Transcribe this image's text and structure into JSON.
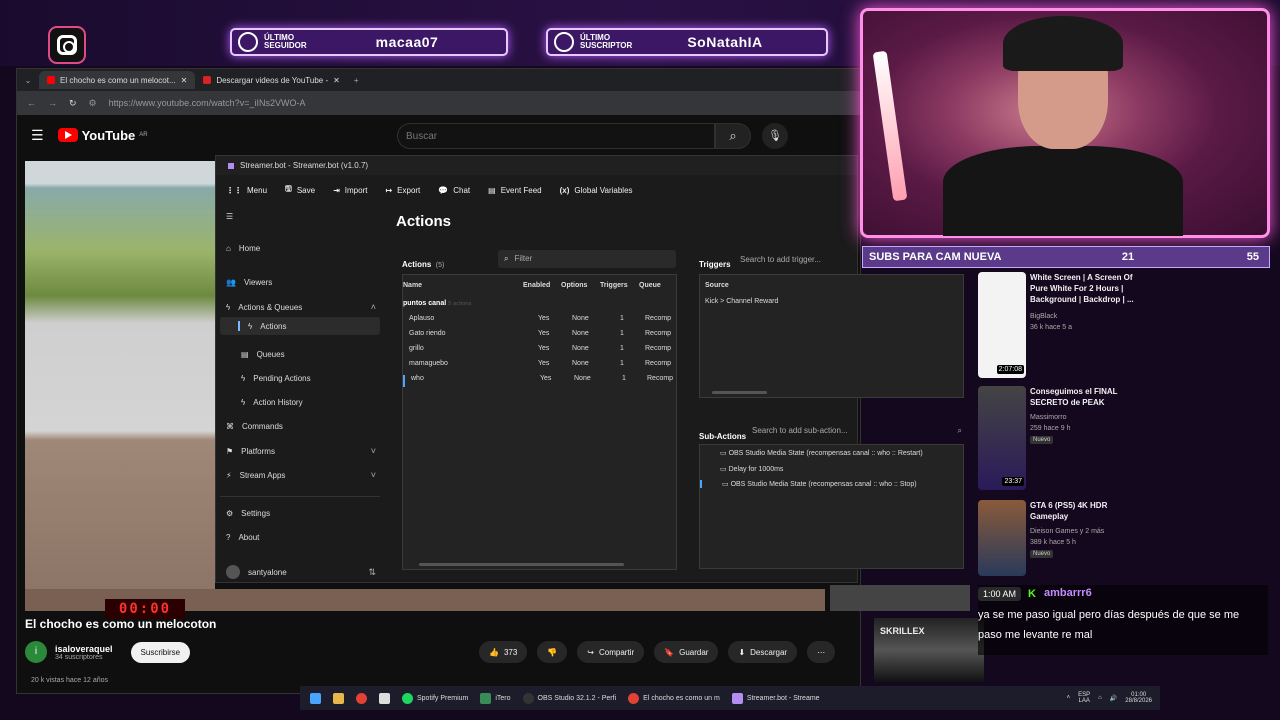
{
  "overlay": {
    "follower_label": "ÚLTIMO SEGUIDOR",
    "follower_name": "macaa07",
    "subscriber_label": "ÚLTIMO SUSCRIPTOR",
    "subscriber_name": "SoNatahIA",
    "subs_goal_label": "SUBS PARA CAM NUEVA",
    "subs_goal_current": "21",
    "subs_goal_target": "55",
    "timer": "00:00"
  },
  "browser": {
    "tabs": [
      "El chocho es como un melocot...",
      "Descargar videos de YouTube -"
    ],
    "url": "https://www.youtube.com/watch?v=_iINs2VWO-A"
  },
  "youtube": {
    "logo": "YouTube",
    "logo_region": "AR",
    "search_placeholder": "Buscar",
    "video_title": "El chocho es como un melocoton",
    "channel_initial": "i",
    "channel_name": "isaloveraquel",
    "channel_subs": "34 suscriptores",
    "subscribe": "Suscribirse",
    "likes": "373",
    "share": "Compartir",
    "save": "Guardar",
    "download": "Descargar",
    "views": "20 k vistas  hace 12 años"
  },
  "streamerbot": {
    "window_title": "Streamer.bot - Streamer.bot (v1.0.7)",
    "menu": [
      "Menu",
      "Save",
      "Import",
      "Export",
      "Chat",
      "Event Feed",
      "Global Variables"
    ],
    "sidebar": {
      "home": "Home",
      "viewers": "Viewers",
      "actions_queues": "Actions & Queues",
      "actions": "Actions",
      "queues": "Queues",
      "pending": "Pending Actions",
      "history": "Action History",
      "commands": "Commands",
      "platforms": "Platforms",
      "stream_apps": "Stream Apps",
      "settings": "Settings",
      "about": "About",
      "user": "santyalone"
    },
    "page_title": "Actions",
    "actions_label": "Actions",
    "actions_count": "(5)",
    "filter_placeholder": "Filter",
    "columns": [
      "Name",
      "Enabled",
      "Options",
      "Triggers",
      "Queue"
    ],
    "group_name": "puntos canal",
    "group_count": "5 actions",
    "rows": [
      {
        "name": "Aplauso",
        "enabled": "Yes",
        "options": "None",
        "triggers": "1",
        "queue": "Recomp"
      },
      {
        "name": "Gato riendo",
        "enabled": "Yes",
        "options": "None",
        "triggers": "1",
        "queue": "Recomp"
      },
      {
        "name": "grillo",
        "enabled": "Yes",
        "options": "None",
        "triggers": "1",
        "queue": "Recomp"
      },
      {
        "name": "mamaguebo",
        "enabled": "Yes",
        "options": "None",
        "triggers": "1",
        "queue": "Recomp"
      },
      {
        "name": "who",
        "enabled": "Yes",
        "options": "None",
        "triggers": "1",
        "queue": "Recomp"
      }
    ],
    "triggers_label": "Triggers",
    "triggers_search": "Search to add trigger...",
    "source_col": "Source",
    "trigger_item": "Kick > Channel Reward",
    "subactions_label": "Sub-Actions",
    "subactions_search": "Search to add sub-action...",
    "subactions": [
      "OBS Studio Media State (recompensas canal :: who :: Restart)",
      "Delay for 1000ms",
      "OBS Studio Media State (recompensas canal :: who :: Stop)"
    ]
  },
  "recommendations": [
    {
      "title": "White Screen | A Screen Of Pure White For 2 Hours | Background | Backdrop | ...",
      "channel": "BigBlack",
      "meta": "36 k  hace 5 a",
      "duration": "2:07:08",
      "badge": ""
    },
    {
      "title": "Conseguimos el FINAL SECRETO de PEAK",
      "channel": "Massimorro",
      "meta": "259  hace 9 h",
      "duration": "23:37",
      "badge": "Nuevo"
    },
    {
      "title": "GTA 6 (PS5) 4K HDR Gameplay",
      "channel": "Dieison Games  y 2 más",
      "meta": "389 k  hace 5 h",
      "duration": "",
      "badge": "Nuevo"
    }
  ],
  "skrillex_label": "SKRILLEX",
  "chat": {
    "time": "1:00 AM",
    "user": "ambarrr6",
    "message": "ya se me paso igual pero días después de que se me paso me levante re mal"
  },
  "taskbar": {
    "apps": [
      "Spotify Premium",
      "iTero",
      "OBS Studio 32.1.2 - Perfi",
      "El chocho es como un m",
      "Streamer.bot - Streame"
    ],
    "lang": "ESP",
    "region": "LAA",
    "time": "01:00",
    "date": "28/8/2026"
  },
  "colors": {
    "accent": "#b45cff",
    "kick": "#53fc18",
    "yt_red": "#ff0000"
  }
}
